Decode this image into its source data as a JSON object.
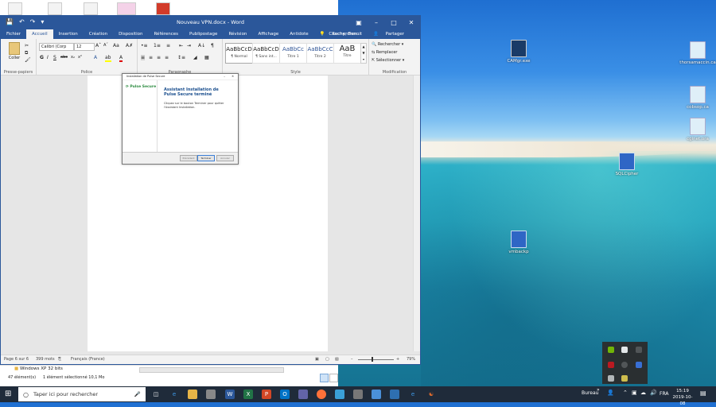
{
  "desktop": {
    "icons": [
      {
        "label": "CAMgr.exe",
        "color": "#e9e2b0"
      },
      {
        "label": "thorsamaccin.ca",
        "color": "#d7ecf7"
      },
      {
        "label": "cobsop.ca",
        "color": "#d7ecf7"
      },
      {
        "label": "cginet.ora",
        "color": "#d7ecf7"
      },
      {
        "label": "SQLCipher",
        "color": "#1d4fa1"
      },
      {
        "label": "vmbackp",
        "color": "#1d4fa1"
      }
    ]
  },
  "word": {
    "title": "Nouveau VPN.docx - Word",
    "tabs": [
      "Fichier",
      "Accueil",
      "Insertion",
      "Création",
      "Disposition",
      "Références",
      "Publipostage",
      "Révision",
      "Affichage",
      "Antidote"
    ],
    "tell_me": "Rechercher...",
    "user": "Cauchy, Benoit",
    "share": "Partager",
    "clipboard": {
      "paste": "Coller",
      "label": "Presse-papiers"
    },
    "font": {
      "name": "Calibri (Corp",
      "size": "12",
      "label": "Police"
    },
    "paragraph_label": "Paragraphe",
    "styles": [
      {
        "sample": "AaBbCcD",
        "name": "¶ Normal"
      },
      {
        "sample": "AaBbCcD",
        "name": "¶ Sans int..."
      },
      {
        "sample": "AaBbCc",
        "name": "Titre 1"
      },
      {
        "sample": "AaBbCcC",
        "name": "Titre 2"
      },
      {
        "sample": "AaB",
        "name": "Titre"
      }
    ],
    "styles_label": "Style",
    "editing": {
      "find": "Rechercher",
      "replace": "Remplacer",
      "select": "Sélectionner",
      "label": "Modification"
    },
    "status": {
      "page": "Page 6 sur 6",
      "words": "399 mots",
      "lang": "Français (France)",
      "zoom": "79%"
    }
  },
  "dialog": {
    "title": "Installation de Pulse Secure",
    "brand": "Pulse Secure",
    "heading": "Assistant Installation de Pulse Secure terminé",
    "body": "Cliquez sur le bouton Terminer pour quitter l'Assistant Installation.",
    "buttons": [
      "Précédent",
      "Terminer",
      "Annuler"
    ]
  },
  "explorer": {
    "folder": "Windows XP 32 bits",
    "count": "47 élément(s)",
    "selection": "1 élément sélectionné 10,1 Mo"
  },
  "taskbar": {
    "search_placeholder": "Taper ici pour rechercher",
    "desktop_label": "Bureau",
    "lang": "FRA",
    "time": "15:19",
    "date": "2019-10-08"
  }
}
